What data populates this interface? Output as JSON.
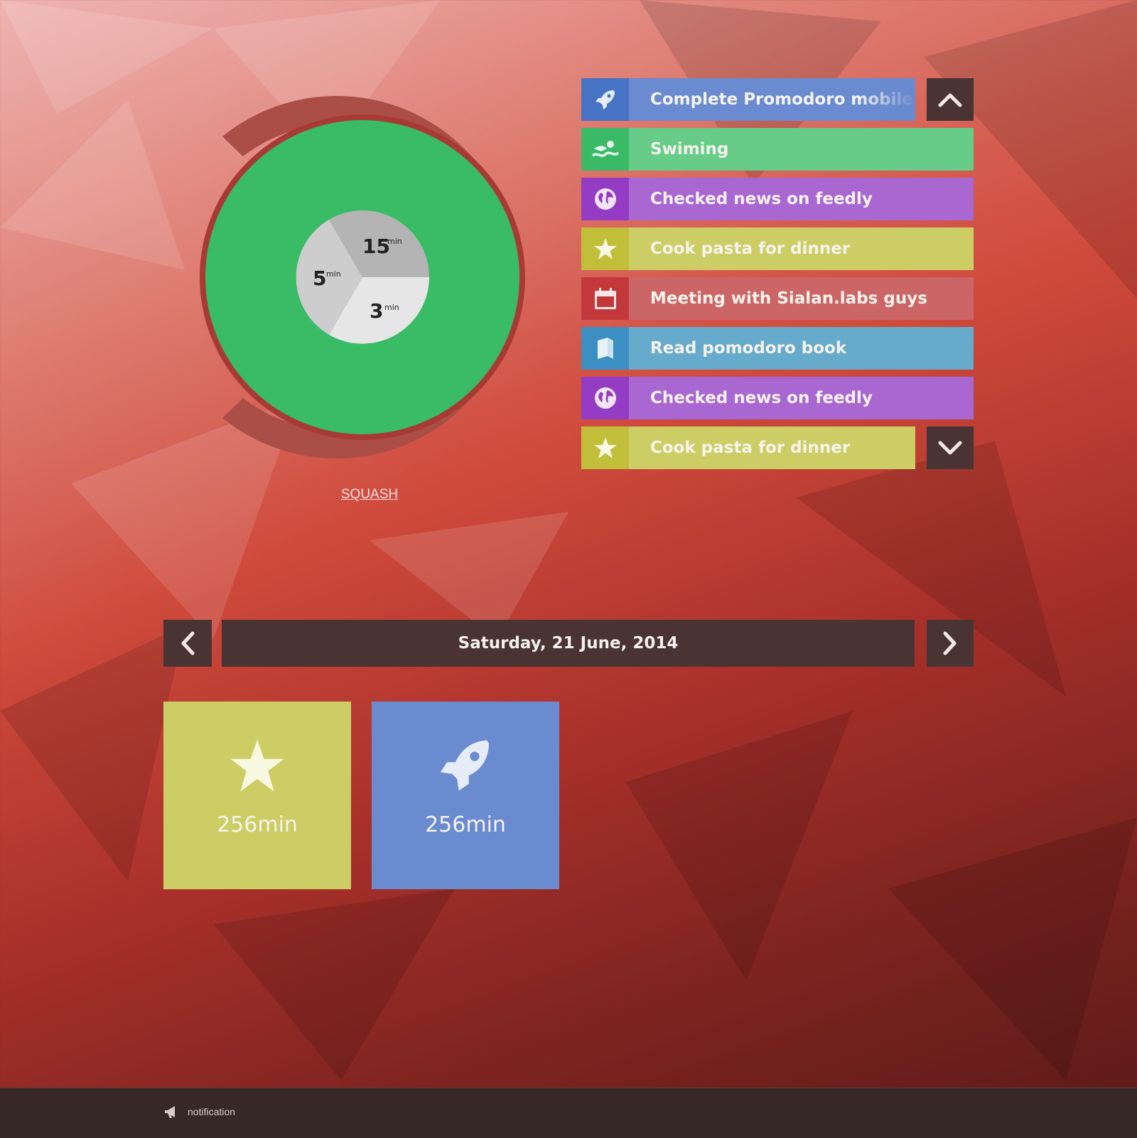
{
  "timer": {
    "segments": [
      {
        "value": "15",
        "unit": "min"
      },
      {
        "value": "5",
        "unit": "min"
      },
      {
        "value": "3",
        "unit": "min"
      }
    ],
    "link_label": "SQUASH",
    "colors": {
      "ring": "#aa4e46",
      "progress": "#3abb66"
    }
  },
  "tasks": [
    {
      "label": "Complete Promodoro mobile circle",
      "icon": "rocket-icon",
      "icon_bg": "#4773c5",
      "bg": "#6a8bd0"
    },
    {
      "label": "Swiming",
      "icon": "swimmer-icon",
      "icon_bg": "#3aba66",
      "bg": "#66cc88"
    },
    {
      "label": "Checked news on feedly",
      "icon": "globe-icon",
      "icon_bg": "#943cc4",
      "bg": "#a967d2"
    },
    {
      "label": "Cook pasta for dinner",
      "icon": "star-icon",
      "icon_bg": "#c1bf3a",
      "bg": "#cdcd66"
    },
    {
      "label": "Meeting with Sialan.labs guys",
      "icon": "calendar-icon",
      "icon_bg": "#c2383b",
      "bg": "#cc6666"
    },
    {
      "label": "Read pomodoro book",
      "icon": "book-icon",
      "icon_bg": "#3b8fc2",
      "bg": "#66aacc"
    },
    {
      "label": "Checked news on feedly",
      "icon": "globe-icon",
      "icon_bg": "#943cc4",
      "bg": "#a967d2"
    },
    {
      "label": "Cook pasta for dinner",
      "icon": "star-icon",
      "icon_bg": "#c1bf3a",
      "bg": "#cdcd66"
    }
  ],
  "date": {
    "label": "Saturday, 21 June, 2014"
  },
  "stats": [
    {
      "value": "256min",
      "icon": "star-icon",
      "bg": "#cdcd66"
    },
    {
      "value": "256min",
      "icon": "rocket-icon",
      "bg": "#6a8bd0"
    }
  ],
  "footer": {
    "notification_label": "notification"
  }
}
